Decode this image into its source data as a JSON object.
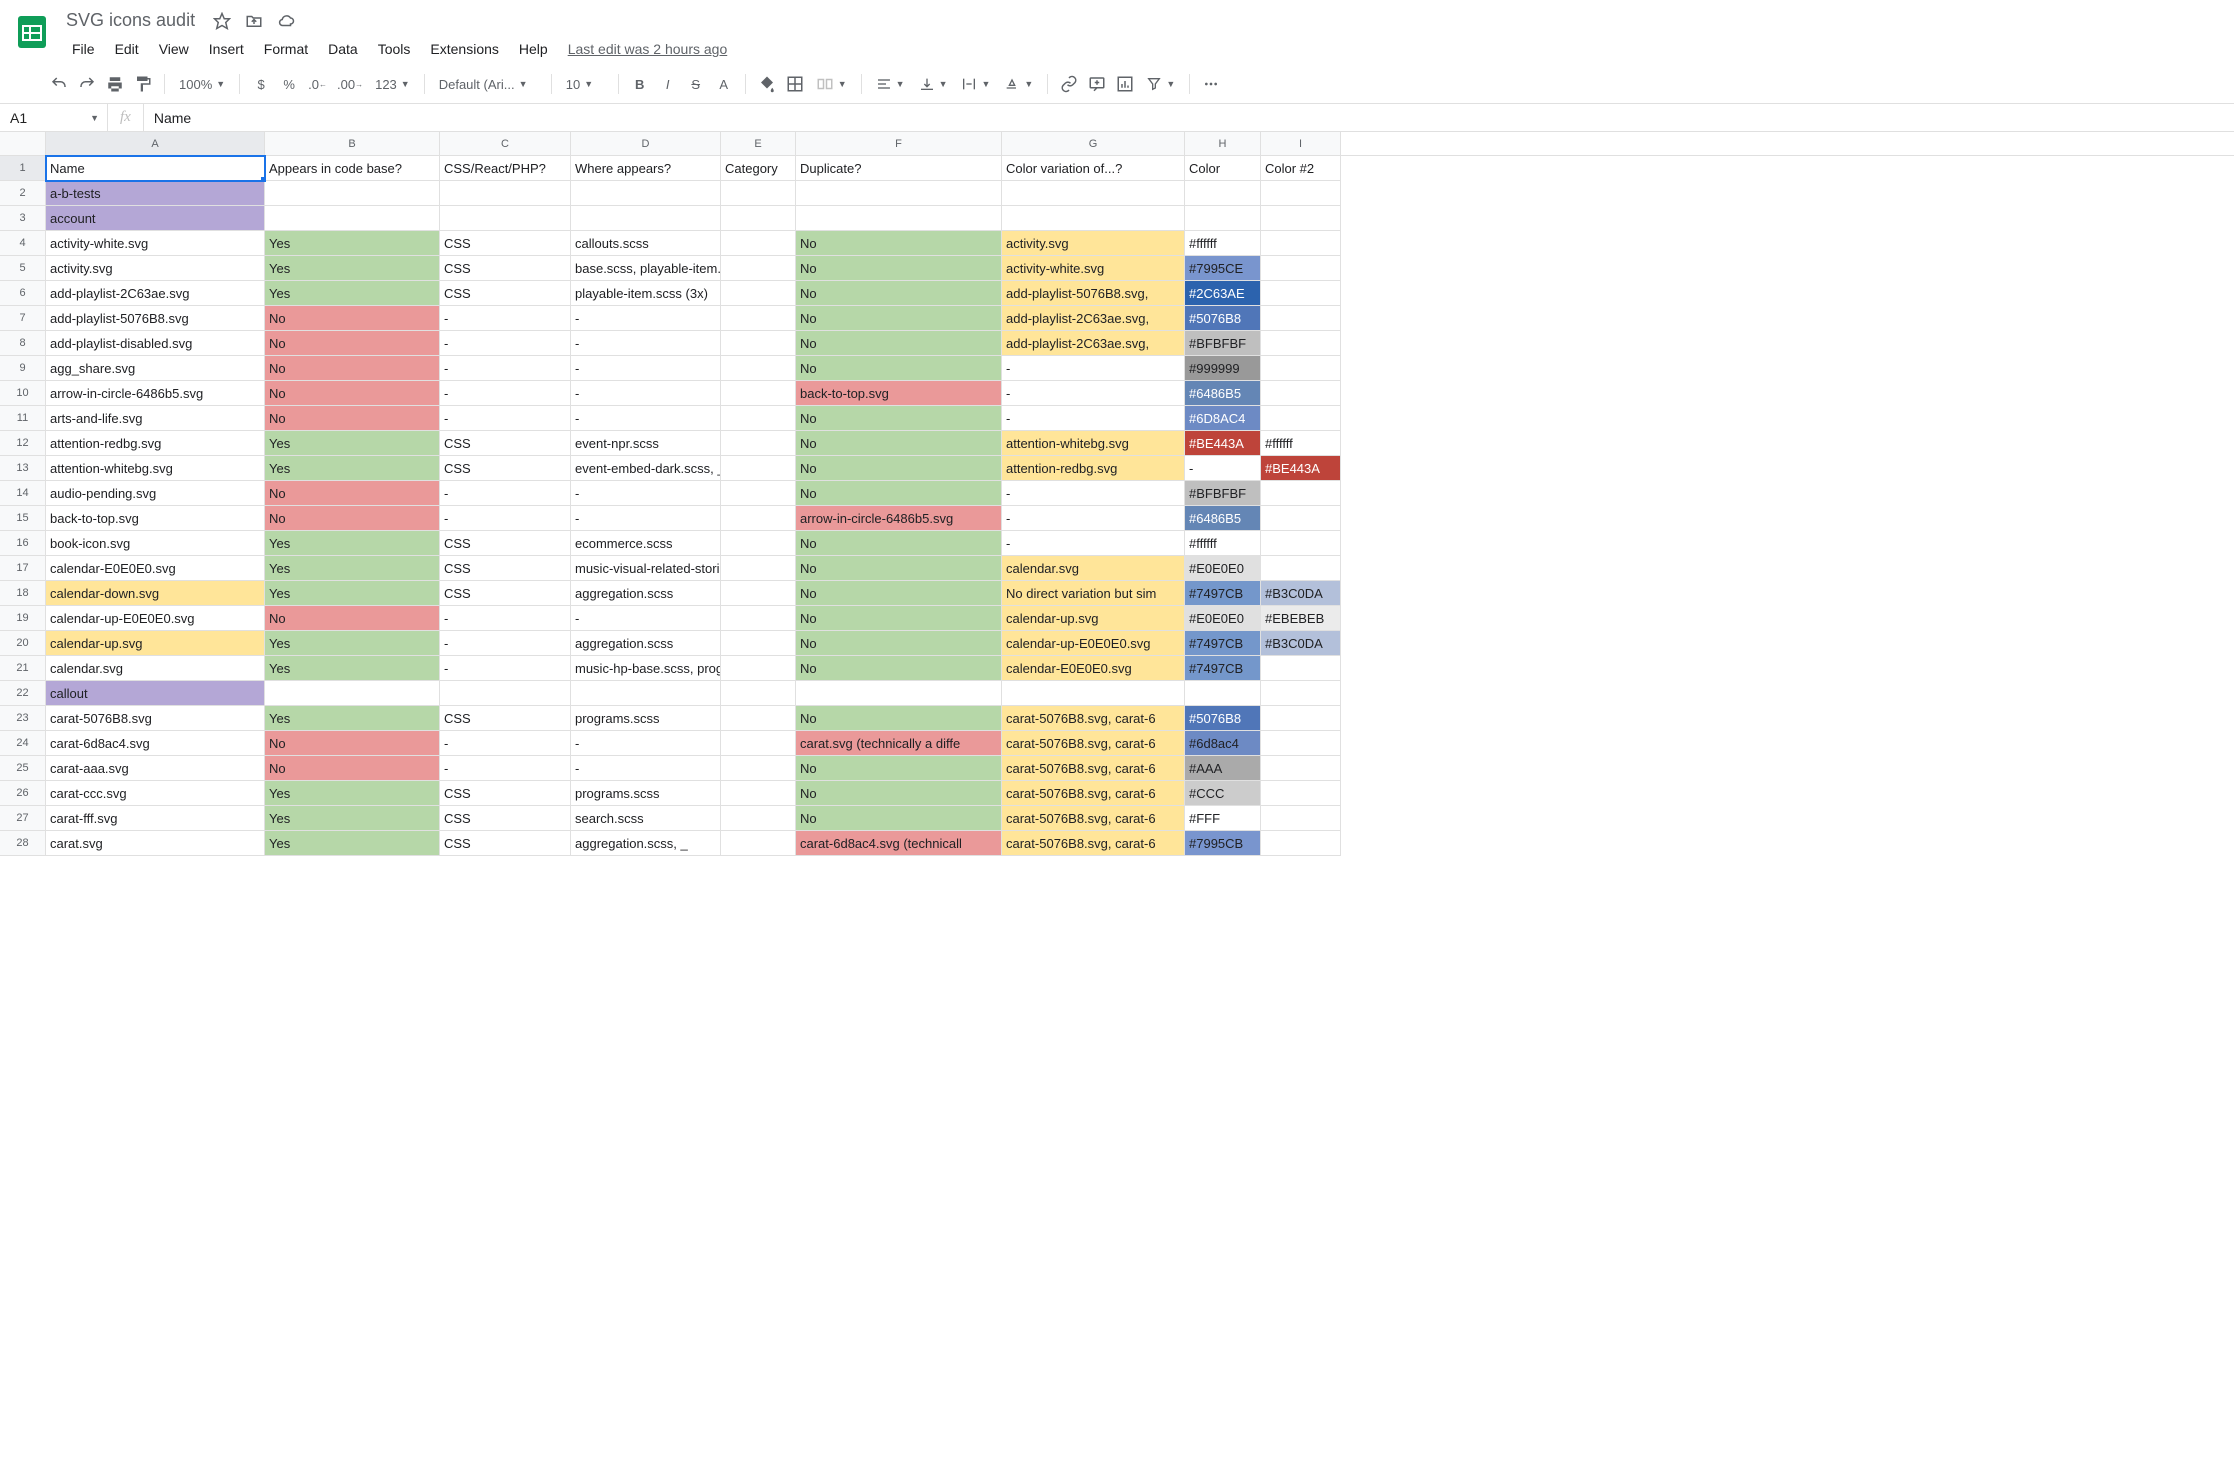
{
  "doc_title": "SVG icons audit",
  "last_edit": "Last edit was 2 hours ago",
  "menus": [
    "File",
    "Edit",
    "View",
    "Insert",
    "Format",
    "Data",
    "Tools",
    "Extensions",
    "Help"
  ],
  "toolbar": {
    "zoom": "100%",
    "font": "Default (Ari...",
    "font_size": "10",
    "currency": "$",
    "percent": "%",
    "dec_dec": ".0",
    "inc_dec": ".00",
    "more_fmt": "123"
  },
  "name_box": "A1",
  "fx": "fx",
  "formula_value": "Name",
  "columns": [
    "A",
    "B",
    "C",
    "D",
    "E",
    "F",
    "G",
    "H",
    "I"
  ],
  "col_widths": [
    "cA",
    "cB",
    "cC",
    "cD",
    "cE",
    "cF",
    "cG",
    "cH",
    "cI"
  ],
  "colors": {
    "purple": "#b4a7d6",
    "green": "#b6d7a8",
    "red": "#ea9999",
    "yellow": "#ffe599",
    "be443a": "#BE443A",
    "be443a_text": "#fff",
    "c7995ce": "#7995CE",
    "c2c63ae": "#2C63AE",
    "c5076b8": "#5076B8",
    "cbfbfbf": "#BFBFBF",
    "c999999": "#999999",
    "c6486b5": "#6486B5",
    "c6d8ac4": "#6D8AC4",
    "ce0e0e0": "#E0E0E0",
    "c7497cb": "#7497CB",
    "cb3c0da": "#B3C0DA",
    "cebebeb": "#EBEBEB",
    "caaa": "#AAA",
    "cccc": "#CCC",
    "c6d8ac4b": "#6d8ac4"
  },
  "rows": [
    {
      "n": 1,
      "cells": [
        {
          "t": "Name"
        },
        {
          "t": "Appears in code base?"
        },
        {
          "t": "CSS/React/PHP?"
        },
        {
          "t": "Where appears?"
        },
        {
          "t": "Category"
        },
        {
          "t": "Duplicate?"
        },
        {
          "t": "Color variation of...?"
        },
        {
          "t": "Color"
        },
        {
          "t": "Color #2"
        }
      ]
    },
    {
      "n": 2,
      "cells": [
        {
          "t": "a-b-tests",
          "bg": "#b4a7d6"
        },
        {
          "t": ""
        },
        {
          "t": ""
        },
        {
          "t": ""
        },
        {
          "t": ""
        },
        {
          "t": ""
        },
        {
          "t": ""
        },
        {
          "t": ""
        },
        {
          "t": ""
        }
      ]
    },
    {
      "n": 3,
      "cells": [
        {
          "t": "account",
          "bg": "#b4a7d6"
        },
        {
          "t": ""
        },
        {
          "t": ""
        },
        {
          "t": ""
        },
        {
          "t": ""
        },
        {
          "t": ""
        },
        {
          "t": ""
        },
        {
          "t": ""
        },
        {
          "t": ""
        }
      ]
    },
    {
      "n": 4,
      "cells": [
        {
          "t": "activity-white.svg"
        },
        {
          "t": "Yes",
          "bg": "#b6d7a8"
        },
        {
          "t": "CSS"
        },
        {
          "t": "callouts.scss"
        },
        {
          "t": ""
        },
        {
          "t": "No",
          "bg": "#b6d7a8"
        },
        {
          "t": "activity.svg",
          "bg": "#ffe599"
        },
        {
          "t": "#ffffff"
        },
        {
          "t": ""
        }
      ]
    },
    {
      "n": 5,
      "cells": [
        {
          "t": "activity.svg"
        },
        {
          "t": "Yes",
          "bg": "#b6d7a8"
        },
        {
          "t": "CSS"
        },
        {
          "t": "base.scss, playable-item.scss"
        },
        {
          "t": ""
        },
        {
          "t": "No",
          "bg": "#b6d7a8"
        },
        {
          "t": "activity-white.svg",
          "bg": "#ffe599"
        },
        {
          "t": "#7995CE",
          "bg": "#7995CE"
        },
        {
          "t": ""
        }
      ]
    },
    {
      "n": 6,
      "cells": [
        {
          "t": "add-playlist-2C63ae.svg"
        },
        {
          "t": "Yes",
          "bg": "#b6d7a8"
        },
        {
          "t": "CSS"
        },
        {
          "t": "playable-item.scss (3x)"
        },
        {
          "t": ""
        },
        {
          "t": "No",
          "bg": "#b6d7a8"
        },
        {
          "t": "add-playlist-5076B8.svg,",
          "bg": "#ffe599"
        },
        {
          "t": "#2C63AE",
          "bg": "#2C63AE",
          "fg": "#fff"
        },
        {
          "t": ""
        }
      ]
    },
    {
      "n": 7,
      "cells": [
        {
          "t": "add-playlist-5076B8.svg"
        },
        {
          "t": "No",
          "bg": "#ea9999"
        },
        {
          "t": "-"
        },
        {
          "t": "-"
        },
        {
          "t": ""
        },
        {
          "t": "No",
          "bg": "#b6d7a8"
        },
        {
          "t": "add-playlist-2C63ae.svg,",
          "bg": "#ffe599"
        },
        {
          "t": "#5076B8",
          "bg": "#5076B8",
          "fg": "#fff"
        },
        {
          "t": ""
        }
      ]
    },
    {
      "n": 8,
      "cells": [
        {
          "t": "add-playlist-disabled.svg"
        },
        {
          "t": "No",
          "bg": "#ea9999"
        },
        {
          "t": "-"
        },
        {
          "t": "-"
        },
        {
          "t": ""
        },
        {
          "t": "No",
          "bg": "#b6d7a8"
        },
        {
          "t": "add-playlist-2C63ae.svg,",
          "bg": "#ffe599"
        },
        {
          "t": "#BFBFBF",
          "bg": "#BFBFBF"
        },
        {
          "t": ""
        }
      ]
    },
    {
      "n": 9,
      "cells": [
        {
          "t": "agg_share.svg"
        },
        {
          "t": "No",
          "bg": "#ea9999"
        },
        {
          "t": "-"
        },
        {
          "t": "-"
        },
        {
          "t": ""
        },
        {
          "t": "No",
          "bg": "#b6d7a8"
        },
        {
          "t": "-"
        },
        {
          "t": "#999999",
          "bg": "#999999"
        },
        {
          "t": ""
        }
      ]
    },
    {
      "n": 10,
      "cells": [
        {
          "t": "arrow-in-circle-6486b5.svg"
        },
        {
          "t": "No",
          "bg": "#ea9999"
        },
        {
          "t": "-"
        },
        {
          "t": "-"
        },
        {
          "t": ""
        },
        {
          "t": "back-to-top.svg",
          "bg": "#ea9999"
        },
        {
          "t": "-"
        },
        {
          "t": "#6486B5",
          "bg": "#6486B5",
          "fg": "#fff"
        },
        {
          "t": ""
        }
      ]
    },
    {
      "n": 11,
      "cells": [
        {
          "t": "arts-and-life.svg"
        },
        {
          "t": "No",
          "bg": "#ea9999"
        },
        {
          "t": "-"
        },
        {
          "t": "-"
        },
        {
          "t": ""
        },
        {
          "t": "No",
          "bg": "#b6d7a8"
        },
        {
          "t": "-"
        },
        {
          "t": "#6D8AC4",
          "bg": "#6D8AC4",
          "fg": "#fff"
        },
        {
          "t": ""
        }
      ]
    },
    {
      "n": 12,
      "cells": [
        {
          "t": "attention-redbg.svg"
        },
        {
          "t": "Yes",
          "bg": "#b6d7a8"
        },
        {
          "t": "CSS"
        },
        {
          "t": "event-npr.scss"
        },
        {
          "t": ""
        },
        {
          "t": "No",
          "bg": "#b6d7a8"
        },
        {
          "t": "attention-whitebg.svg",
          "bg": "#ffe599"
        },
        {
          "t": "#BE443A",
          "bg": "#BE443A",
          "fg": "#fff"
        },
        {
          "t": "#ffffff"
        }
      ]
    },
    {
      "n": 13,
      "cells": [
        {
          "t": "attention-whitebg.svg"
        },
        {
          "t": "Yes",
          "bg": "#b6d7a8"
        },
        {
          "t": "CSS"
        },
        {
          "t": "event-embed-dark.scss, _ever"
        },
        {
          "t": ""
        },
        {
          "t": "No",
          "bg": "#b6d7a8"
        },
        {
          "t": "attention-redbg.svg",
          "bg": "#ffe599"
        },
        {
          "t": "-"
        },
        {
          "t": "#BE443A",
          "bg": "#BE443A",
          "fg": "#fff"
        }
      ]
    },
    {
      "n": 14,
      "cells": [
        {
          "t": "audio-pending.svg"
        },
        {
          "t": "No",
          "bg": "#ea9999"
        },
        {
          "t": "-"
        },
        {
          "t": "-"
        },
        {
          "t": ""
        },
        {
          "t": "No",
          "bg": "#b6d7a8"
        },
        {
          "t": "-"
        },
        {
          "t": "#BFBFBF",
          "bg": "#BFBFBF"
        },
        {
          "t": ""
        }
      ]
    },
    {
      "n": 15,
      "cells": [
        {
          "t": "back-to-top.svg"
        },
        {
          "t": "No",
          "bg": "#ea9999"
        },
        {
          "t": "-"
        },
        {
          "t": "-"
        },
        {
          "t": ""
        },
        {
          "t": "arrow-in-circle-6486b5.svg",
          "bg": "#ea9999"
        },
        {
          "t": "-"
        },
        {
          "t": "#6486B5",
          "bg": "#6486B5",
          "fg": "#fff"
        },
        {
          "t": ""
        }
      ]
    },
    {
      "n": 16,
      "cells": [
        {
          "t": "book-icon.svg"
        },
        {
          "t": "Yes",
          "bg": "#b6d7a8"
        },
        {
          "t": "CSS"
        },
        {
          "t": "ecommerce.scss"
        },
        {
          "t": ""
        },
        {
          "t": "No",
          "bg": "#b6d7a8"
        },
        {
          "t": "-"
        },
        {
          "t": "#ffffff"
        },
        {
          "t": ""
        }
      ]
    },
    {
      "n": 17,
      "cells": [
        {
          "t": "calendar-E0E0E0.svg"
        },
        {
          "t": "Yes",
          "bg": "#b6d7a8"
        },
        {
          "t": "CSS"
        },
        {
          "t": "music-visual-related-stories.sc"
        },
        {
          "t": ""
        },
        {
          "t": "No",
          "bg": "#b6d7a8"
        },
        {
          "t": "calendar.svg",
          "bg": "#ffe599"
        },
        {
          "t": "#E0E0E0",
          "bg": "#E0E0E0"
        },
        {
          "t": ""
        }
      ]
    },
    {
      "n": 18,
      "cells": [
        {
          "t": "calendar-down.svg",
          "bg": "#ffe599"
        },
        {
          "t": "Yes",
          "bg": "#b6d7a8"
        },
        {
          "t": "CSS"
        },
        {
          "t": "aggregation.scss"
        },
        {
          "t": ""
        },
        {
          "t": "No",
          "bg": "#b6d7a8"
        },
        {
          "t": "No direct variation but sim",
          "bg": "#ffe599"
        },
        {
          "t": "#7497CB",
          "bg": "#7497CB"
        },
        {
          "t": "#B3C0DA",
          "bg": "#B3C0DA"
        }
      ]
    },
    {
      "n": 19,
      "cells": [
        {
          "t": "calendar-up-E0E0E0.svg"
        },
        {
          "t": "No",
          "bg": "#ea9999"
        },
        {
          "t": "-"
        },
        {
          "t": "-"
        },
        {
          "t": ""
        },
        {
          "t": "No",
          "bg": "#b6d7a8"
        },
        {
          "t": "calendar-up.svg",
          "bg": "#ffe599"
        },
        {
          "t": "#E0E0E0",
          "bg": "#E0E0E0"
        },
        {
          "t": "#EBEBEB",
          "bg": "#EBEBEB"
        }
      ]
    },
    {
      "n": 20,
      "cells": [
        {
          "t": "calendar-up.svg",
          "bg": "#ffe599"
        },
        {
          "t": "Yes",
          "bg": "#b6d7a8"
        },
        {
          "t": "-"
        },
        {
          "t": "aggregation.scss"
        },
        {
          "t": ""
        },
        {
          "t": "No",
          "bg": "#b6d7a8"
        },
        {
          "t": "calendar-up-E0E0E0.svg",
          "bg": "#ffe599"
        },
        {
          "t": "#7497CB",
          "bg": "#7497CB"
        },
        {
          "t": "#B3C0DA",
          "bg": "#B3C0DA"
        }
      ]
    },
    {
      "n": 21,
      "cells": [
        {
          "t": "calendar.svg"
        },
        {
          "t": "Yes",
          "bg": "#b6d7a8"
        },
        {
          "t": "-"
        },
        {
          "t": "music-hp-base.scss, programs"
        },
        {
          "t": ""
        },
        {
          "t": "No",
          "bg": "#b6d7a8"
        },
        {
          "t": "calendar-E0E0E0.svg",
          "bg": "#ffe599"
        },
        {
          "t": "#7497CB",
          "bg": "#7497CB"
        },
        {
          "t": ""
        }
      ]
    },
    {
      "n": 22,
      "cells": [
        {
          "t": "callout",
          "bg": "#b4a7d6"
        },
        {
          "t": ""
        },
        {
          "t": ""
        },
        {
          "t": ""
        },
        {
          "t": ""
        },
        {
          "t": ""
        },
        {
          "t": ""
        },
        {
          "t": ""
        },
        {
          "t": ""
        }
      ]
    },
    {
      "n": 23,
      "cells": [
        {
          "t": "carat-5076B8.svg"
        },
        {
          "t": "Yes",
          "bg": "#b6d7a8"
        },
        {
          "t": "CSS"
        },
        {
          "t": "programs.scss"
        },
        {
          "t": ""
        },
        {
          "t": "No",
          "bg": "#b6d7a8"
        },
        {
          "t": "carat-5076B8.svg, carat-6",
          "bg": "#ffe599"
        },
        {
          "t": "#5076B8",
          "bg": "#5076B8",
          "fg": "#fff"
        },
        {
          "t": ""
        }
      ]
    },
    {
      "n": 24,
      "cells": [
        {
          "t": "carat-6d8ac4.svg"
        },
        {
          "t": "No",
          "bg": "#ea9999"
        },
        {
          "t": "-"
        },
        {
          "t": "-"
        },
        {
          "t": ""
        },
        {
          "t": "carat.svg (technically a diffe",
          "bg": "#ea9999"
        },
        {
          "t": "carat-5076B8.svg, carat-6",
          "bg": "#ffe599"
        },
        {
          "t": "#6d8ac4",
          "bg": "#6d8ac4"
        },
        {
          "t": ""
        }
      ]
    },
    {
      "n": 25,
      "cells": [
        {
          "t": "carat-aaa.svg"
        },
        {
          "t": "No",
          "bg": "#ea9999"
        },
        {
          "t": "-"
        },
        {
          "t": "-"
        },
        {
          "t": ""
        },
        {
          "t": "No",
          "bg": "#b6d7a8"
        },
        {
          "t": "carat-5076B8.svg, carat-6",
          "bg": "#ffe599"
        },
        {
          "t": "#AAA",
          "bg": "#AAA"
        },
        {
          "t": ""
        }
      ]
    },
    {
      "n": 26,
      "cells": [
        {
          "t": "carat-ccc.svg"
        },
        {
          "t": "Yes",
          "bg": "#b6d7a8"
        },
        {
          "t": "CSS"
        },
        {
          "t": "programs.scss"
        },
        {
          "t": ""
        },
        {
          "t": "No",
          "bg": "#b6d7a8"
        },
        {
          "t": "carat-5076B8.svg, carat-6",
          "bg": "#ffe599"
        },
        {
          "t": "#CCC",
          "bg": "#CCC"
        },
        {
          "t": ""
        }
      ]
    },
    {
      "n": 27,
      "cells": [
        {
          "t": "carat-fff.svg"
        },
        {
          "t": "Yes",
          "bg": "#b6d7a8"
        },
        {
          "t": "CSS"
        },
        {
          "t": "search.scss"
        },
        {
          "t": ""
        },
        {
          "t": "No",
          "bg": "#b6d7a8"
        },
        {
          "t": "carat-5076B8.svg, carat-6",
          "bg": "#ffe599"
        },
        {
          "t": "#FFF"
        },
        {
          "t": ""
        }
      ]
    },
    {
      "n": 28,
      "cells": [
        {
          "t": "carat.svg"
        },
        {
          "t": "Yes",
          "bg": "#b6d7a8"
        },
        {
          "t": "CSS"
        },
        {
          "t": "aggregation.scss, _"
        },
        {
          "t": ""
        },
        {
          "t": "carat-6d8ac4.svg (technicall",
          "bg": "#ea9999"
        },
        {
          "t": "carat-5076B8.svg, carat-6",
          "bg": "#ffe599"
        },
        {
          "t": "#7995CB",
          "bg": "#7995CE"
        },
        {
          "t": ""
        }
      ]
    }
  ]
}
